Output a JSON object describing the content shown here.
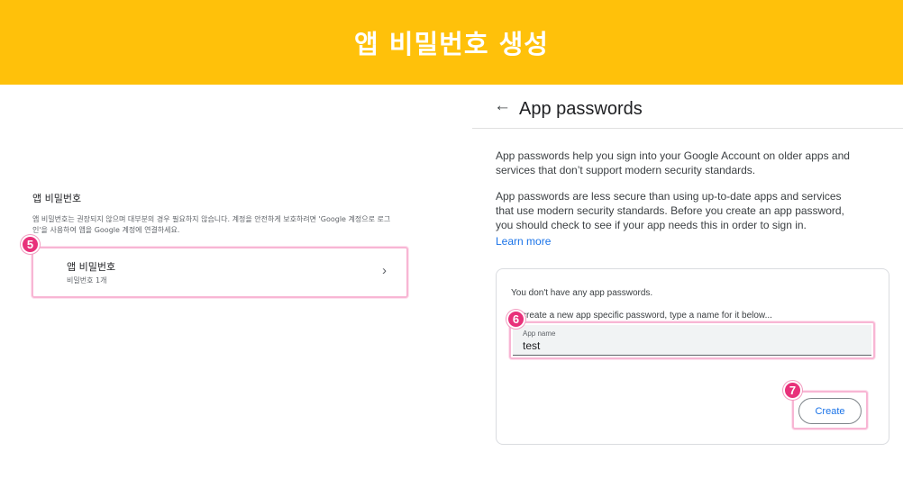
{
  "banner": {
    "title": "앱 비밀번호 생성"
  },
  "left": {
    "heading": "앱 비밀번호",
    "description": "앱 비밀번호는 권장되지 않으며 대부분의 경우 필요하지 않습니다. 계정을 안전하게 보호하려면 'Google 계정으로 로그인'을 사용하여 앱을 Google 계정에 연결하세요.",
    "row": {
      "title": "앱 비밀번호",
      "subtitle": "비밀번호 1개",
      "chevron": "›"
    }
  },
  "steps": {
    "s5": "5",
    "s6": "6",
    "s7": "7"
  },
  "right": {
    "back_icon": "←",
    "title": "App passwords",
    "paragraph1": "App passwords help you sign into your Google Account on older apps and services that don’t support modern security standards.",
    "paragraph2": "App passwords are less secure than using up-to-date apps and services that use modern security standards. Before you create an app password, you should check to see if your app needs this in order to sign in.",
    "learn_more": "Learn more",
    "card": {
      "empty_text": "You don't have any app passwords.",
      "hint": "create a new app specific password, type a name for it below...",
      "field_label": "App name",
      "field_value": "test",
      "create_button": "Create"
    }
  },
  "colors": {
    "banner": "#ffc10a",
    "badge": "#e8317a",
    "highlight": "#f8b6d4",
    "link": "#1a73e8"
  }
}
